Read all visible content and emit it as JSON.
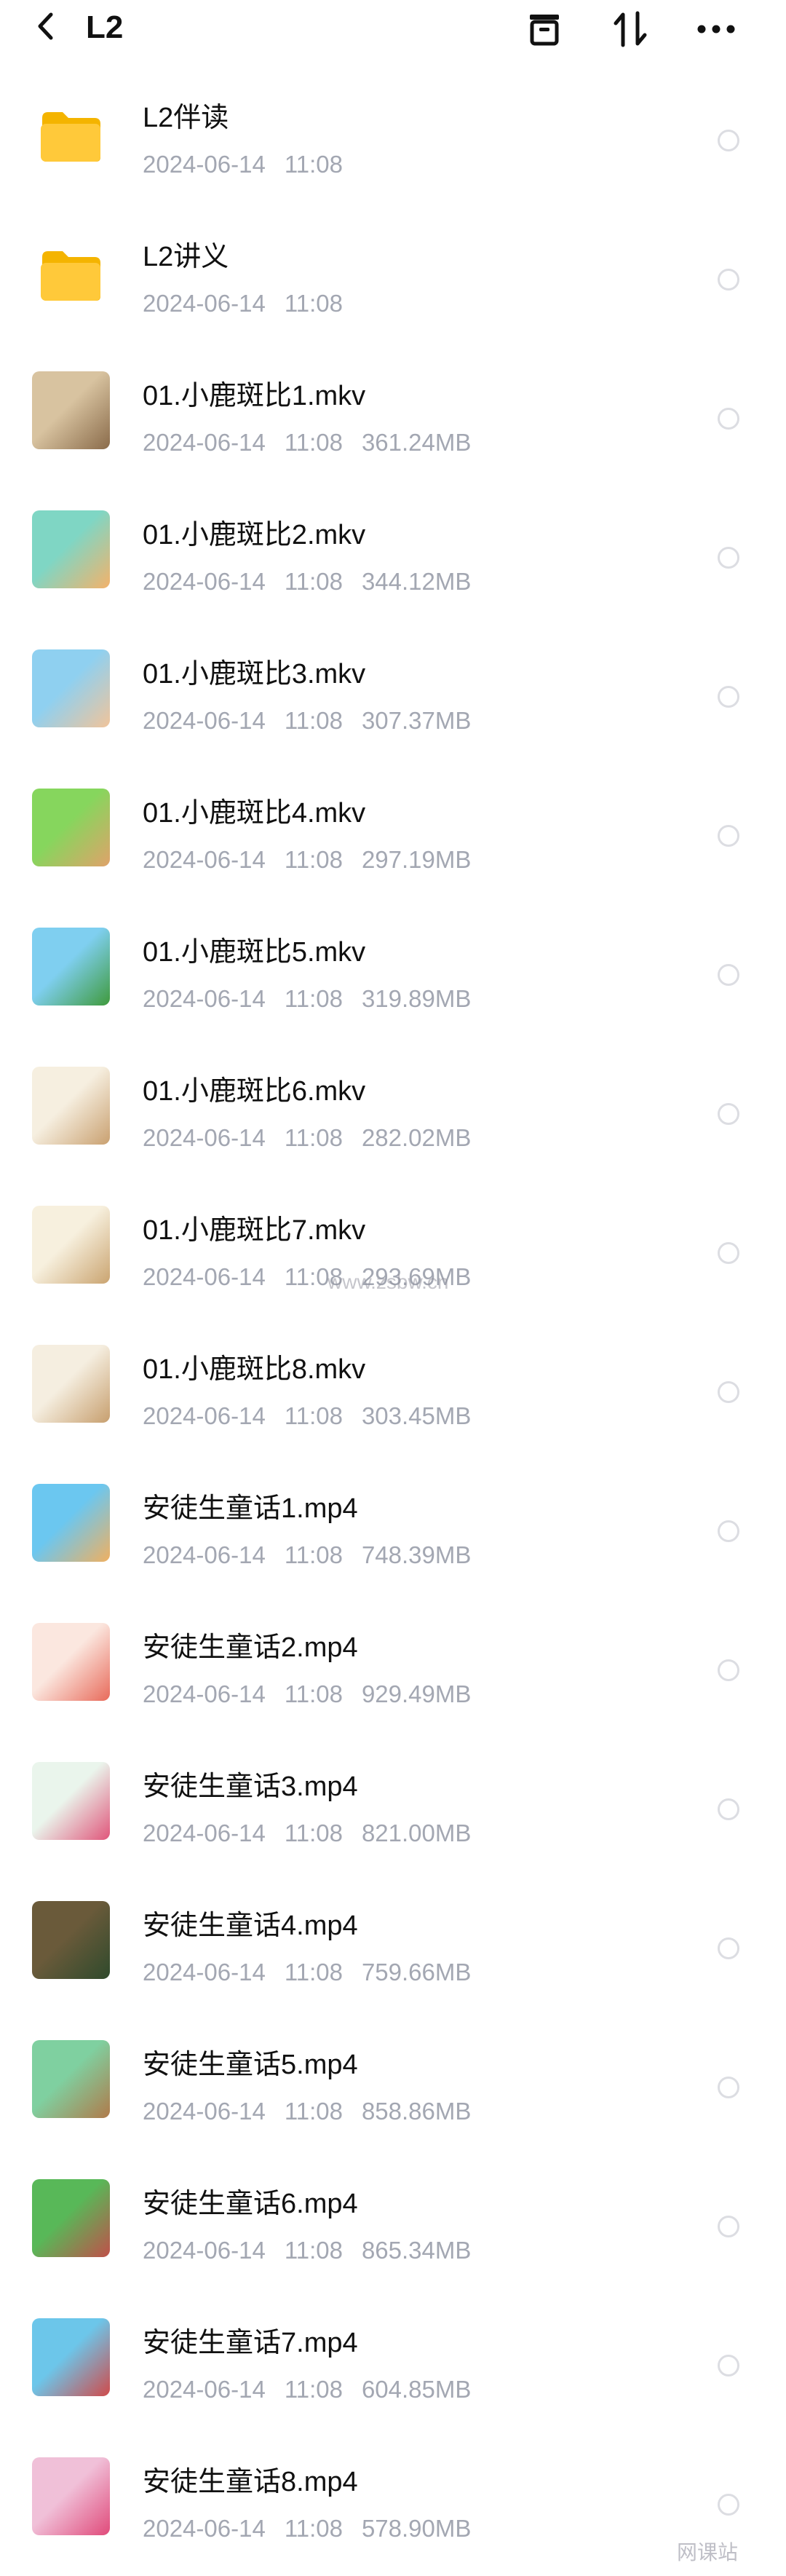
{
  "header": {
    "title": "L2",
    "back_icon": "chevron-left-icon",
    "actions": [
      "archive-box-icon",
      "sort-arrows-icon",
      "more-dots-icon"
    ]
  },
  "files": [
    {
      "name": "L2伴读",
      "date": "2024-06-14",
      "time": "11:08",
      "size": "",
      "type": "folder"
    },
    {
      "name": "L2讲义",
      "date": "2024-06-14",
      "time": "11:08",
      "size": "",
      "type": "folder"
    },
    {
      "name": "01.小鹿斑比1.mkv",
      "date": "2024-06-14",
      "time": "11:08",
      "size": "361.24MB",
      "type": "video",
      "thumb": [
        "#d8c3a0",
        "#8a6b4a"
      ]
    },
    {
      "name": "01.小鹿斑比2.mkv",
      "date": "2024-06-14",
      "time": "11:08",
      "size": "344.12MB",
      "type": "video",
      "thumb": [
        "#7fd6c4",
        "#f4b26a"
      ]
    },
    {
      "name": "01.小鹿斑比3.mkv",
      "date": "2024-06-14",
      "time": "11:08",
      "size": "307.37MB",
      "type": "video",
      "thumb": [
        "#8fd0f0",
        "#f1c49a"
      ]
    },
    {
      "name": "01.小鹿斑比4.mkv",
      "date": "2024-06-14",
      "time": "11:08",
      "size": "297.19MB",
      "type": "video",
      "thumb": [
        "#86d65d",
        "#e0a26a"
      ]
    },
    {
      "name": "01.小鹿斑比5.mkv",
      "date": "2024-06-14",
      "time": "11:08",
      "size": "319.89MB",
      "type": "video",
      "thumb": [
        "#7fcff0",
        "#3f9a3c"
      ]
    },
    {
      "name": "01.小鹿斑比6.mkv",
      "date": "2024-06-14",
      "time": "11:08",
      "size": "282.02MB",
      "type": "video",
      "thumb": [
        "#f6efe0",
        "#c9a070"
      ]
    },
    {
      "name": "01.小鹿斑比7.mkv",
      "date": "2024-06-14",
      "time": "11:08",
      "size": "293.69MB",
      "type": "video",
      "thumb": [
        "#f7f0de",
        "#caa470"
      ]
    },
    {
      "name": "01.小鹿斑比8.mkv",
      "date": "2024-06-14",
      "time": "11:08",
      "size": "303.45MB",
      "type": "video",
      "thumb": [
        "#f5eee0",
        "#c79f6e"
      ]
    },
    {
      "name": "安徒生童话1.mp4",
      "date": "2024-06-14",
      "time": "11:08",
      "size": "748.39MB",
      "type": "video",
      "thumb": [
        "#6bc7f0",
        "#f0b060"
      ]
    },
    {
      "name": "安徒生童话2.mp4",
      "date": "2024-06-14",
      "time": "11:08",
      "size": "929.49MB",
      "type": "video",
      "thumb": [
        "#fbe7df",
        "#e86a5a"
      ]
    },
    {
      "name": "安徒生童话3.mp4",
      "date": "2024-06-14",
      "time": "11:08",
      "size": "821.00MB",
      "type": "video",
      "thumb": [
        "#eaf5ec",
        "#e0557a"
      ]
    },
    {
      "name": "安徒生童话4.mp4",
      "date": "2024-06-14",
      "time": "11:08",
      "size": "759.66MB",
      "type": "video",
      "thumb": [
        "#6a5a3a",
        "#2f4a2c"
      ]
    },
    {
      "name": "安徒生童话5.mp4",
      "date": "2024-06-14",
      "time": "11:08",
      "size": "858.86MB",
      "type": "video",
      "thumb": [
        "#7fd0a0",
        "#b07a4a"
      ]
    },
    {
      "name": "安徒生童话6.mp4",
      "date": "2024-06-14",
      "time": "11:08",
      "size": "865.34MB",
      "type": "video",
      "thumb": [
        "#58b858",
        "#c0504a"
      ]
    },
    {
      "name": "安徒生童话7.mp4",
      "date": "2024-06-14",
      "time": "11:08",
      "size": "604.85MB",
      "type": "video",
      "thumb": [
        "#6cc6ea",
        "#d04a4a"
      ]
    },
    {
      "name": "安徒生童话8.mp4",
      "date": "2024-06-14",
      "time": "11:08",
      "size": "578.90MB",
      "type": "video",
      "thumb": [
        "#f0c0d8",
        "#e04a7a"
      ]
    }
  ],
  "watermarks": {
    "center": "www.zsbw.cn",
    "corner": "网课站"
  },
  "colors": {
    "folder": "#ffc93a",
    "folder_dark": "#f4b400",
    "meta_text": "#a3a7b2",
    "radio_border": "#dcdde2"
  }
}
